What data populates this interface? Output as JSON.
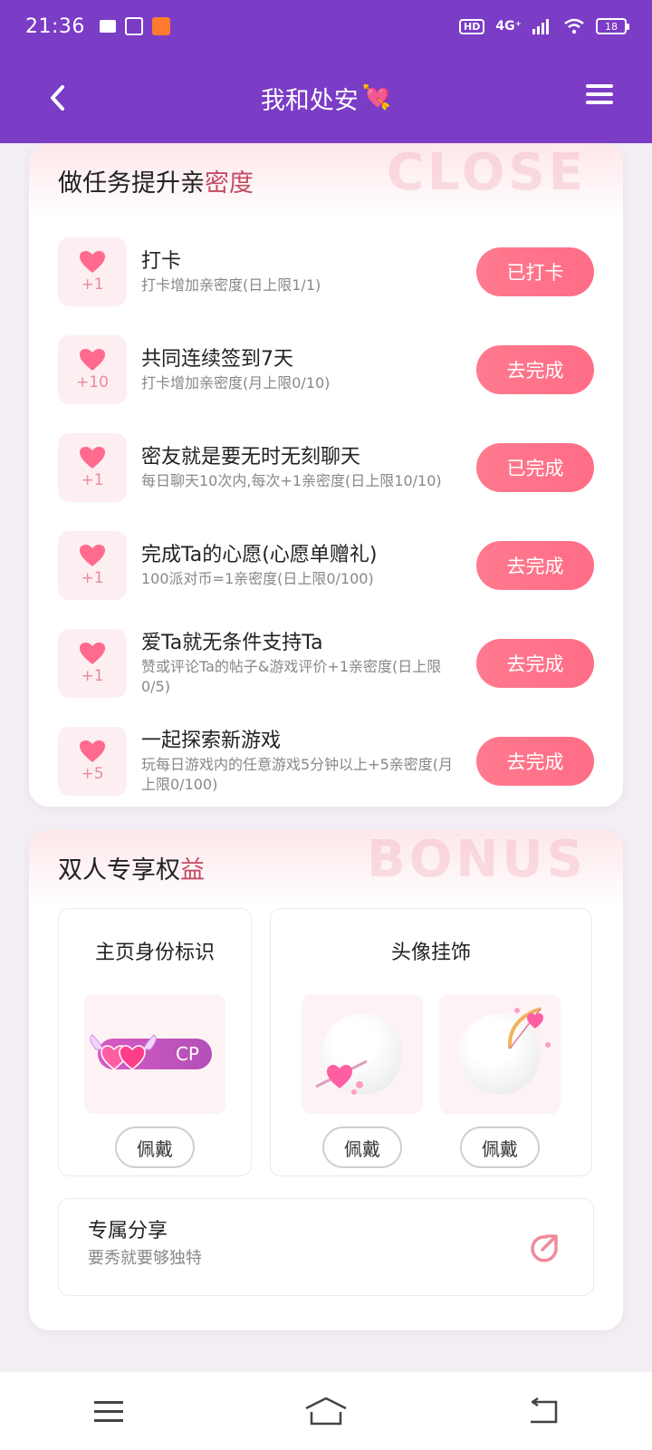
{
  "status_bar": {
    "time": "21:36",
    "network": "4G⁺",
    "hd": "HD",
    "battery": "18"
  },
  "header": {
    "title": "我和处安",
    "title_emoji": "💘"
  },
  "tasks_section": {
    "title_main": "做任务提升亲",
    "title_accent": "密度",
    "watermark": "CLOSE",
    "tasks": [
      {
        "points": "+1",
        "title": "打卡",
        "desc": "打卡增加亲密度(日上限1/1)",
        "button": "已打卡"
      },
      {
        "points": "+10",
        "title": "共同连续签到7天",
        "desc": "打卡增加亲密度(月上限0/10)",
        "button": "去完成"
      },
      {
        "points": "+1",
        "title": "密友就是要无时无刻聊天",
        "desc": "每日聊天10次内,每次+1亲密度(日上限10/10)",
        "button": "已完成"
      },
      {
        "points": "+1",
        "title": "完成Ta的心愿(心愿单赠礼)",
        "desc": "100派对币=1亲密度(日上限0/100)",
        "button": "去完成"
      },
      {
        "points": "+1",
        "title": "爱Ta就无条件支持Ta",
        "desc": "赞或评论Ta的帖子&游戏评价+1亲密度(日上限0/5)",
        "button": "去完成"
      },
      {
        "points": "+5",
        "title": "一起探索新游戏",
        "desc": "玩每日游戏内的任意游戏5分钟以上+5亲密度(月上限0/100)",
        "button": "去完成"
      }
    ]
  },
  "bonus_section": {
    "title_main": "双人专享权",
    "title_accent": "益",
    "watermark": "BONUS",
    "identity": {
      "title": "主页身份标识",
      "badge_text": "CP",
      "button": "佩戴"
    },
    "avatar_frame": {
      "title": "头像挂饰",
      "items": [
        {
          "button": "佩戴"
        },
        {
          "button": "佩戴"
        }
      ]
    },
    "share": {
      "title": "专属分享",
      "desc": "要秀就要够独特"
    }
  },
  "colors": {
    "header_bg": "#7b3cc6",
    "button_pink": "#ff7088",
    "heart": "#ff6a8e",
    "accent_text": "#c24b63"
  },
  "icons": {
    "back": "chevron-left-icon",
    "menu": "hamburger-menu-icon",
    "heart": "heart-icon",
    "share": "share-arrow-icon",
    "nav_menu": "menu-icon",
    "nav_home": "home-icon",
    "nav_back": "back-icon"
  }
}
